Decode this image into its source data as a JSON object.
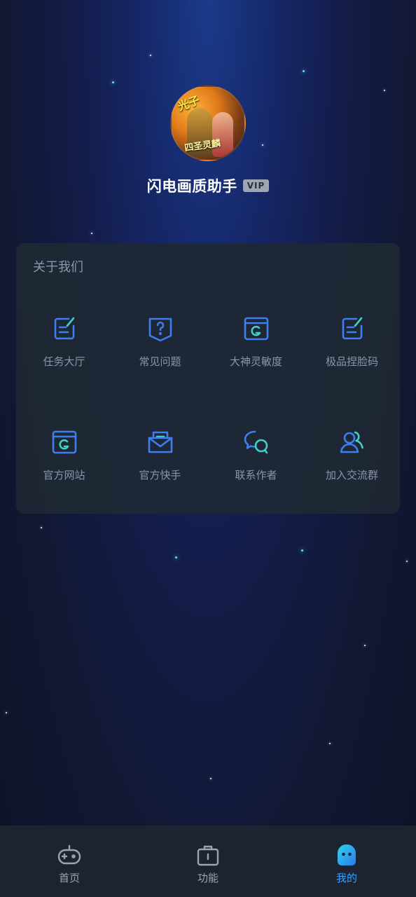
{
  "profile": {
    "name": "闪电画质助手",
    "vip_badge": "VIP",
    "avatar_text_top": "光子",
    "avatar_text_bottom": "四圣灵麟"
  },
  "about": {
    "title": "关于我们",
    "items": [
      {
        "label": "任务大厅",
        "icon": "edit-note-icon"
      },
      {
        "label": "常见问题",
        "icon": "question-shield-icon"
      },
      {
        "label": "大神灵敏度",
        "icon": "g-window-icon"
      },
      {
        "label": "极品捏脸码",
        "icon": "edit-note-icon"
      },
      {
        "label": "官方网站",
        "icon": "g-window-icon"
      },
      {
        "label": "官方快手",
        "icon": "mail-open-icon"
      },
      {
        "label": "联系作者",
        "icon": "chat-bubbles-icon"
      },
      {
        "label": "加入交流群",
        "icon": "users-icon"
      }
    ]
  },
  "tabbar": {
    "tabs": [
      {
        "label": "首页",
        "icon": "gamepad-icon",
        "active": false
      },
      {
        "label": "功能",
        "icon": "toolbox-icon",
        "active": false
      },
      {
        "label": "我的",
        "icon": "robot-avatar-icon",
        "active": true
      }
    ]
  },
  "colors": {
    "accent": "#3aa0ff",
    "icon_blue": "#3d7ef0",
    "icon_teal": "#3fd0c8",
    "card_bg": "#1f2834",
    "tabbar_bg": "#1c2431"
  }
}
